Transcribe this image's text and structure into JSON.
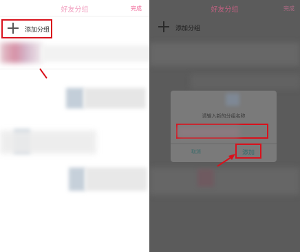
{
  "left_screen": {
    "title": "好友分组",
    "done_label": "完成",
    "add_group_label": "添加分组"
  },
  "right_screen": {
    "title": "好友分组",
    "done_label": "完成",
    "add_group_label": "添加分组",
    "dialog": {
      "title": "请输入新的分组名称",
      "input_value": "",
      "cancel_label": "取消",
      "confirm_label": "添加"
    }
  },
  "colors": {
    "highlight_box": "#d9101b",
    "title_pink": "#f2a0c0",
    "overlay_gray": "#5b5b5b"
  }
}
